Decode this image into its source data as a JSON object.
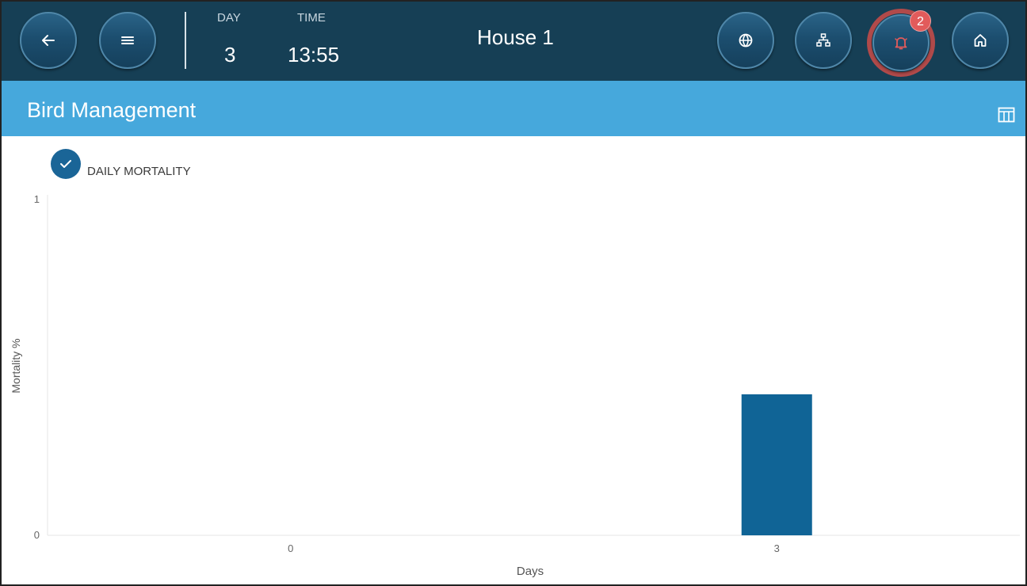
{
  "header": {
    "day_label": "DAY",
    "day_value": "3",
    "time_label": "TIME",
    "time_value": "13:55",
    "house_name": "House 1",
    "alarm_count": "2",
    "buttons": {
      "back": "arrow-left-icon",
      "menu": "hamburger-icon",
      "globe": "globe-icon",
      "network": "network-icon",
      "alarm": "bell-icon",
      "home": "home-icon"
    }
  },
  "page": {
    "title": "Bird Management",
    "view_icon": "table-icon"
  },
  "legend": {
    "label": "DAILY MORTALITY",
    "checked": true
  },
  "colors": {
    "topbar": "#163f55",
    "titlebar": "#46a8dc",
    "bar": "#106496",
    "badge": "#e25b5b"
  },
  "chart_data": {
    "type": "bar",
    "categories": [
      "0",
      "3"
    ],
    "series": [
      {
        "name": "DAILY MORTALITY",
        "values": [
          0,
          0.42
        ]
      }
    ],
    "xlabel": "Days",
    "ylabel": "Mortality %",
    "ylim": [
      0,
      1
    ],
    "yticks": [
      "0",
      "1"
    ],
    "grid": false
  }
}
